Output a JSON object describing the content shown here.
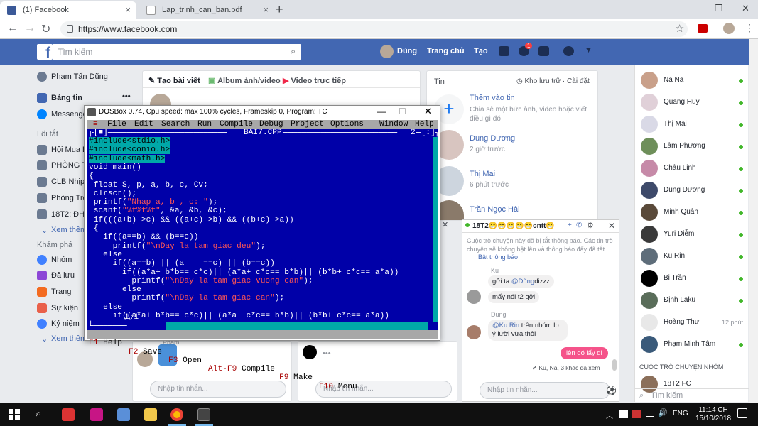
{
  "browser": {
    "tabs": [
      {
        "label": "(1) Facebook"
      },
      {
        "label": "Lap_trinh_can_ban.pdf"
      }
    ],
    "url": "https://www.facebook.com",
    "new_tab": "+",
    "minimize": "—",
    "maximize": "❐",
    "close": "✕"
  },
  "fb": {
    "logo": "f",
    "search_placeholder": "Tìm kiếm",
    "user": "Dũng",
    "home": "Trang chủ",
    "create": "Tạo",
    "notif_badge": "1"
  },
  "left_nav": {
    "profile": "Phạm Tấn Dũng",
    "newsfeed": "Bảng tin",
    "messenger": "Messenger",
    "shortcuts_header": "Lối tắt",
    "shortcuts": [
      "Hội Mua B",
      "PHÒNG T",
      "CLB Nhịp",
      "Phòng Trọ",
      "18T2: ĐHS"
    ],
    "see_more": "Xem thêm",
    "explore_header": "Khám phá",
    "explore": [
      "Nhóm",
      "Đã lưu",
      "Trang",
      "Sự kiện",
      "Kỷ niệm"
    ],
    "see_more2": "Xem thêm"
  },
  "composer": {
    "create_post": "Tạo bài viết",
    "photo": "Album ảnh/video",
    "live": "Video trực tiếp"
  },
  "stories": {
    "title": "Tin",
    "archive": "Kho lưu trữ",
    "settings": "Cài đặt",
    "add": "Thêm vào tin",
    "add_desc": "Chia sẻ một bức ảnh, video hoặc viết điều gì đó",
    "items": [
      {
        "name": "Dung Dương",
        "time": "2 giờ trước"
      },
      {
        "name": "Thị Mai",
        "time": "6 phút trước"
      },
      {
        "name": "Trần Ngọc Hải",
        "time": ""
      }
    ]
  },
  "contacts": [
    {
      "name": "Na Na",
      "time": ""
    },
    {
      "name": "Quang Huy",
      "time": ""
    },
    {
      "name": "Thị Mai",
      "time": ""
    },
    {
      "name": "Lâm Phương",
      "time": ""
    },
    {
      "name": "Châu Linh",
      "time": ""
    },
    {
      "name": "Dung Dương",
      "time": ""
    },
    {
      "name": "Minh Quân",
      "time": ""
    },
    {
      "name": "Yuri Diễm",
      "time": ""
    },
    {
      "name": "Ku Rin",
      "time": ""
    },
    {
      "name": "Bi Trần",
      "time": ""
    },
    {
      "name": "Định Laku",
      "time": ""
    },
    {
      "name": "Hoàng Thư",
      "time": "12 phút"
    },
    {
      "name": "Phạm Minh Tâm",
      "time": ""
    }
  ],
  "group_chats_header": "CUỘC TRÒ CHUYỆN NHÓM",
  "group_chats": [
    {
      "name": "18T2 FC"
    }
  ],
  "contact_search": "Tìm kiếm",
  "chat": {
    "title": "18T2😁😁😁😁😁cntt😁",
    "muted_notice": "Cuộc trò chuyện này đã bị tắt thông báo. Các tin trò chuyện sẽ không bật lên và thông báo đẩy đã tắt.",
    "unmute": "Bật thông báo",
    "sender1": "Ku",
    "msg1": "gởi ta ",
    "mention1": "@Dũng",
    "msg1b": "dizzz",
    "msg2": "mấy nói t2 gởi",
    "sender2": "Dung",
    "mention2": "@Ku Rin",
    "msg3": " trên nhóm lp ý lười vừa thôi",
    "my_msg": "lên đó lấy đi",
    "seen": "Ku, Na, 3 khác đã xem",
    "input_placeholder": "Nhập tin nhắn..."
  },
  "chat_inputs": {
    "left": "Nhập tin nhắn...",
    "mid": "Nhập tin nhắn..."
  },
  "feed_person": "Phạm",
  "dosbox": {
    "title": "DOSBox 0.74, Cpu speed: max 100% cycles, Frameskip  0, Program:     TC",
    "menu": [
      "≡",
      "File",
      "Edit",
      "Search",
      "Run",
      "Compile",
      "Debug",
      "Project",
      "Options",
      "Window",
      "Help"
    ],
    "filename": "BAI7.CPP",
    "window_num": "2",
    "cursor_pos": "1:1",
    "status": [
      {
        "key": "F1",
        "label": "Help"
      },
      {
        "key": "F2",
        "label": "Save"
      },
      {
        "key": "F3",
        "label": "Open"
      },
      {
        "key": "Alt-F9",
        "label": "Compile"
      },
      {
        "key": "F9",
        "label": "Make"
      },
      {
        "key": "F10",
        "label": "Menu"
      }
    ],
    "code": [
      "#include<stdio.h>",
      "#include<conio.h>",
      "#include<math.h>",
      "void main()",
      "{",
      " float S, p, a, b, c, Cv;",
      " clrscr();",
      " printf(\"Nhap a, b , c: \");",
      " scanf(\"%f%f%f\", &a, &b, &c);",
      " if(((a+b) >c) && ((a+c) >b) && ((b+c) >a))",
      " {",
      "   if((a==b) && (b==c))",
      "     printf(\"\\nDay la tam giac deu\");",
      "   else",
      "     if((a==b) || (a    ==c) || (b==c))",
      "       if((a*a+ b*b== c*c)|| (a*a+ c*c== b*b)|| (b*b+ c*c== a*a))",
      "         printf(\"\\nDay la tam giac vuong can\");",
      "       else",
      "         printf(\"\\nDay la tam giac can\");",
      "   else",
      "     if((a*a+ b*b== c*c)|| (a*a+ c*c== b*b)|| (b*b+ c*c== a*a))"
    ]
  },
  "taskbar": {
    "time": "11:14 CH",
    "date": "15/10/2018",
    "lang": "ENG"
  }
}
